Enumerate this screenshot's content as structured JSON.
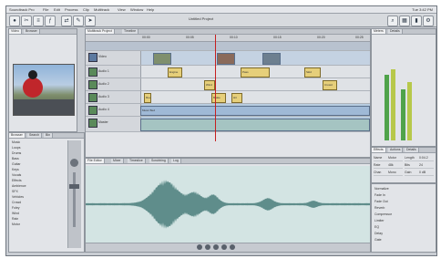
{
  "menubar": {
    "items": [
      "Soundtrack Pro",
      "File",
      "Edit",
      "Process",
      "Clip",
      "Multitrack",
      "View",
      "Window",
      "Help"
    ],
    "clock": "Tue 3:42 PM"
  },
  "window": {
    "title": "Untitled Project"
  },
  "toolbar": {
    "buttons": [
      "rec-icon",
      "cut-icon",
      "mix-icon",
      "fx-icon",
      "route-icon",
      "tool-icon",
      "send-icon",
      "find-icon"
    ]
  },
  "left": {
    "tabs": [
      "Video",
      "Browser"
    ],
    "bin_tabs": [
      "Browser",
      "Search",
      "Bin"
    ],
    "bin_rows": [
      "Music",
      "Loops",
      "Drums",
      "Bass",
      "Guitar",
      "Keys",
      "Vocals",
      "Effects",
      "Ambience",
      "SFX",
      "Vehicles",
      "Crowd",
      "Foley",
      "Wind",
      "Rain",
      "Motor"
    ]
  },
  "timeline": {
    "tabs": [
      "Multitrack Project",
      "Timeline"
    ],
    "ticks": [
      "00:00",
      "00:05",
      "00:10",
      "00:15",
      "00:20",
      "00:25"
    ],
    "tracks": [
      {
        "name": "Video",
        "clips": []
      },
      {
        "name": "Audio 1",
        "clips": [
          "Engine",
          "Pass",
          "Skid"
        ]
      },
      {
        "name": "Audio 2",
        "clips": [
          "Wind",
          "Crowd"
        ]
      },
      {
        "name": "Audio 3",
        "clips": [
          "Rev",
          "Brake",
          "Hit"
        ]
      },
      {
        "name": "Audio 4",
        "clips": [
          "Music Bed"
        ]
      },
      {
        "name": "Master",
        "clips": []
      }
    ]
  },
  "editor": {
    "tabs": [
      "File Editor",
      "Mixer",
      "Timeslice",
      "Scrubbing",
      "Log"
    ]
  },
  "right": {
    "tabs": [
      "Meters",
      "Details"
    ],
    "lower_tabs": [
      "Effects",
      "Actions",
      "Details"
    ],
    "grid": [
      [
        "Name",
        "Motor",
        "Length",
        "0:04.2"
      ],
      [
        "Rate",
        "48k",
        "Bits",
        "24"
      ],
      [
        "Chan",
        "Mono",
        "Gain",
        "0 dB"
      ]
    ],
    "list": [
      "Normalize",
      "Fade In",
      "Fade Out",
      "Reverb",
      "Compressor",
      "Limiter",
      "EQ",
      "Delay",
      "Gate"
    ],
    "meter_values": [
      0.72,
      0.78,
      0.56,
      0.64
    ]
  },
  "colors": {
    "waveform": "#5f8d8b",
    "clip_gold": "#e6cf7a",
    "clip_blue": "#9fb9d6"
  }
}
